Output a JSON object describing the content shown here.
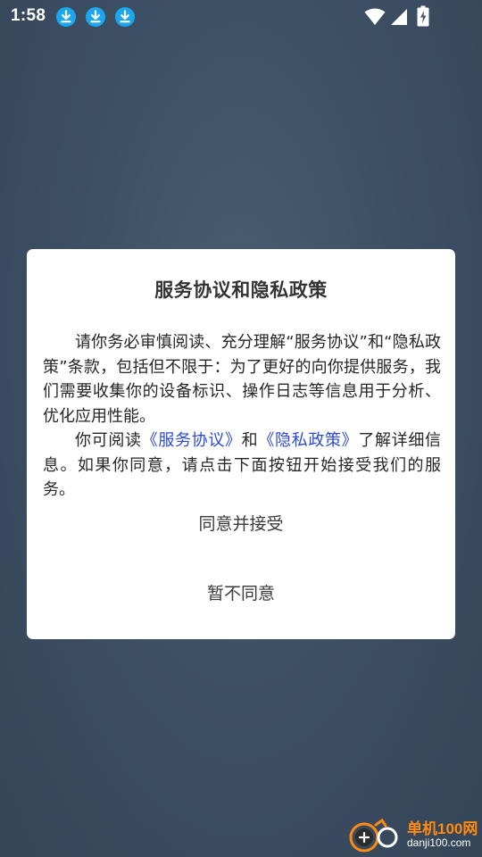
{
  "status_bar": {
    "time": "1:58",
    "notification_icons": [
      "download-icon",
      "download-icon",
      "download-icon"
    ],
    "right_icons": [
      "wifi-icon",
      "cellular-signal-icon",
      "battery-charging-icon"
    ]
  },
  "dialog": {
    "title": "服务协议和隐私政策",
    "paragraph1": "请你务必审慎阅读、充分理解“服务协议”和“隐私政策”条款，包括但不限于：为了更好的向你提供服务，我们需要收集你的设备标识、操作日志等信息用于分析、优化应用性能。",
    "paragraph2": {
      "prefix": "你可阅读",
      "link_service": "《服务协议》",
      "conjunction": "和",
      "link_privacy": "《隐私政策》",
      "suffix": "了解详细信息。如果你同意，请点击下面按钮开始接受我们的服务。"
    },
    "agree_button": "同意并接受",
    "disagree_button": "暂不同意"
  },
  "colors": {
    "overlay_background": "#3d4f63",
    "dialog_background": "#ffffff",
    "link": "#2b4bd6",
    "notification_icon": "#1aa7f0",
    "watermark_orange": "#ff8a12"
  },
  "watermark": {
    "title": "单机100网",
    "url": "danji100.com"
  }
}
